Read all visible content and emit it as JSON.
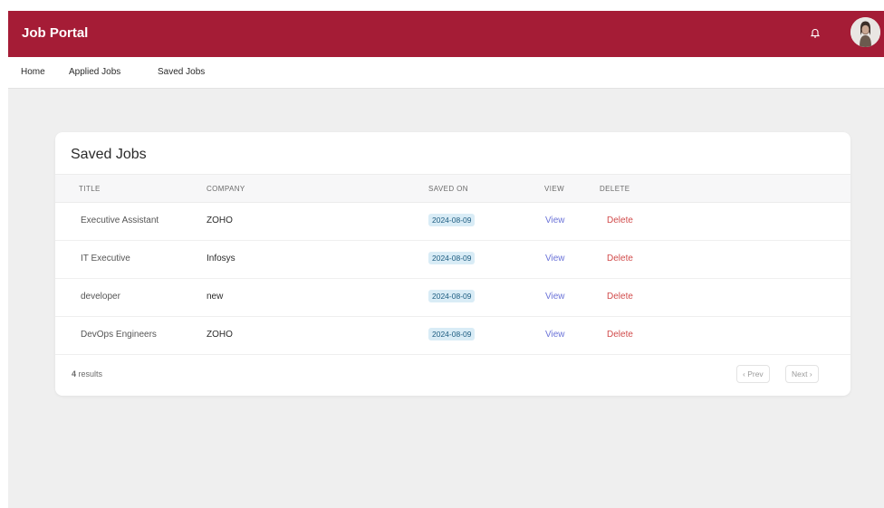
{
  "app": {
    "title": "Job Portal"
  },
  "header": {
    "notification_icon": "bell-icon",
    "avatar_icon": "user-avatar"
  },
  "nav": {
    "links": [
      "Home",
      "Applied Jobs",
      "Saved Jobs"
    ]
  },
  "card": {
    "title": "Saved Jobs",
    "columns": [
      "TITLE",
      "COMPANY",
      "SAVED ON",
      "VIEW",
      "DELETE"
    ],
    "rows": [
      {
        "title": "Executive Assistant",
        "company": "ZOHO",
        "saved_on": "2024-08-09",
        "view": "View",
        "delete": "Delete"
      },
      {
        "title": "IT Executive",
        "company": "Infosys",
        "saved_on": "2024-08-09",
        "view": "View",
        "delete": "Delete"
      },
      {
        "title": "developer",
        "company": "new",
        "saved_on": "2024-08-09",
        "view": "View",
        "delete": "Delete"
      },
      {
        "title": "DevOps Engineers",
        "company": "ZOHO",
        "saved_on": "2024-08-09",
        "view": "View",
        "delete": "Delete"
      }
    ],
    "results_count": "4",
    "results_label": "results",
    "pagination": {
      "prev": "‹ Prev",
      "next": "Next ›"
    }
  },
  "colors": {
    "brand": "#a51c36",
    "background": "#efefef",
    "link": "#6b73d8",
    "danger": "#d14b4b",
    "badge_bg": "#d9ecf6"
  }
}
